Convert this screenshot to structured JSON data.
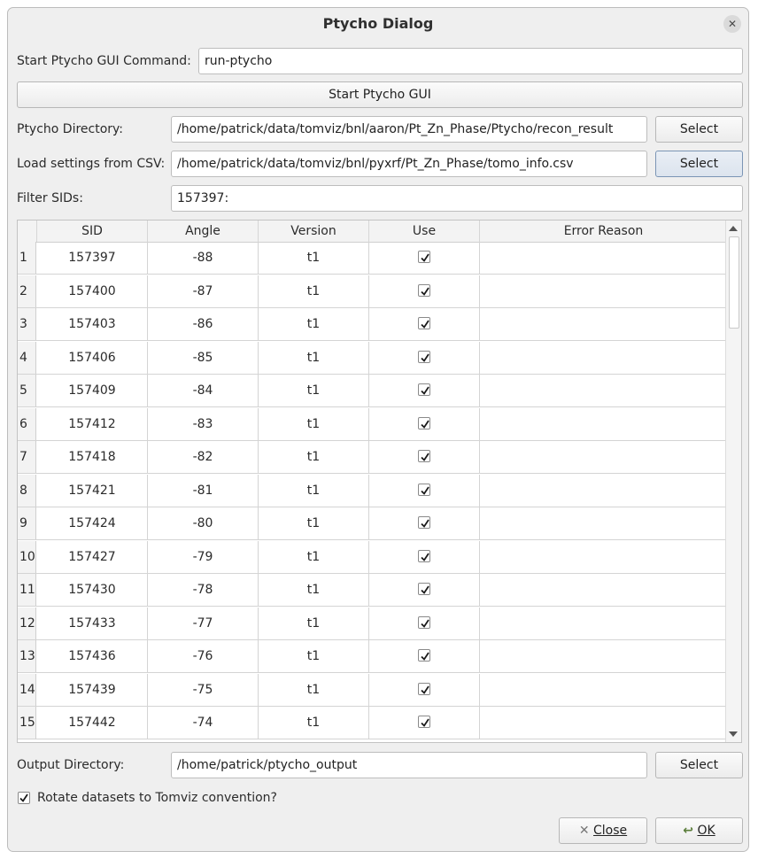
{
  "window": {
    "title": "Ptycho Dialog"
  },
  "command": {
    "label": "Start Ptycho GUI Command:",
    "value": "run-ptycho"
  },
  "start_button": "Start Ptycho GUI",
  "ptycho_dir": {
    "label": "Ptycho Directory:",
    "value": "/home/patrick/data/tomviz/bnl/aaron/Pt_Zn_Phase/Ptycho/recon_result",
    "button": "Select"
  },
  "csv": {
    "label": "Load settings from CSV:",
    "value": "/home/patrick/data/tomviz/bnl/pyxrf/Pt_Zn_Phase/tomo_info.csv",
    "button": "Select"
  },
  "filter": {
    "label": "Filter SIDs:",
    "value": "157397:"
  },
  "table": {
    "headers": [
      "SID",
      "Angle",
      "Version",
      "Use",
      "Error Reason"
    ],
    "rows": [
      {
        "n": "1",
        "sid": "157397",
        "angle": "-88",
        "version": "t1",
        "use": true,
        "error": ""
      },
      {
        "n": "2",
        "sid": "157400",
        "angle": "-87",
        "version": "t1",
        "use": true,
        "error": ""
      },
      {
        "n": "3",
        "sid": "157403",
        "angle": "-86",
        "version": "t1",
        "use": true,
        "error": ""
      },
      {
        "n": "4",
        "sid": "157406",
        "angle": "-85",
        "version": "t1",
        "use": true,
        "error": ""
      },
      {
        "n": "5",
        "sid": "157409",
        "angle": "-84",
        "version": "t1",
        "use": true,
        "error": ""
      },
      {
        "n": "6",
        "sid": "157412",
        "angle": "-83",
        "version": "t1",
        "use": true,
        "error": ""
      },
      {
        "n": "7",
        "sid": "157418",
        "angle": "-82",
        "version": "t1",
        "use": true,
        "error": ""
      },
      {
        "n": "8",
        "sid": "157421",
        "angle": "-81",
        "version": "t1",
        "use": true,
        "error": ""
      },
      {
        "n": "9",
        "sid": "157424",
        "angle": "-80",
        "version": "t1",
        "use": true,
        "error": ""
      },
      {
        "n": "10",
        "sid": "157427",
        "angle": "-79",
        "version": "t1",
        "use": true,
        "error": ""
      },
      {
        "n": "11",
        "sid": "157430",
        "angle": "-78",
        "version": "t1",
        "use": true,
        "error": ""
      },
      {
        "n": "12",
        "sid": "157433",
        "angle": "-77",
        "version": "t1",
        "use": true,
        "error": ""
      },
      {
        "n": "13",
        "sid": "157436",
        "angle": "-76",
        "version": "t1",
        "use": true,
        "error": ""
      },
      {
        "n": "14",
        "sid": "157439",
        "angle": "-75",
        "version": "t1",
        "use": true,
        "error": ""
      },
      {
        "n": "15",
        "sid": "157442",
        "angle": "-74",
        "version": "t1",
        "use": true,
        "error": ""
      }
    ]
  },
  "output_dir": {
    "label": "Output Directory:",
    "value": "/home/patrick/ptycho_output",
    "button": "Select"
  },
  "rotate": {
    "label": "Rotate datasets to Tomviz convention?",
    "checked": true
  },
  "buttons": {
    "close": "Close",
    "ok": "OK"
  },
  "icons": {
    "close_window": "close-icon",
    "close_button": "x-icon",
    "ok_button": "check-arrow-icon"
  }
}
